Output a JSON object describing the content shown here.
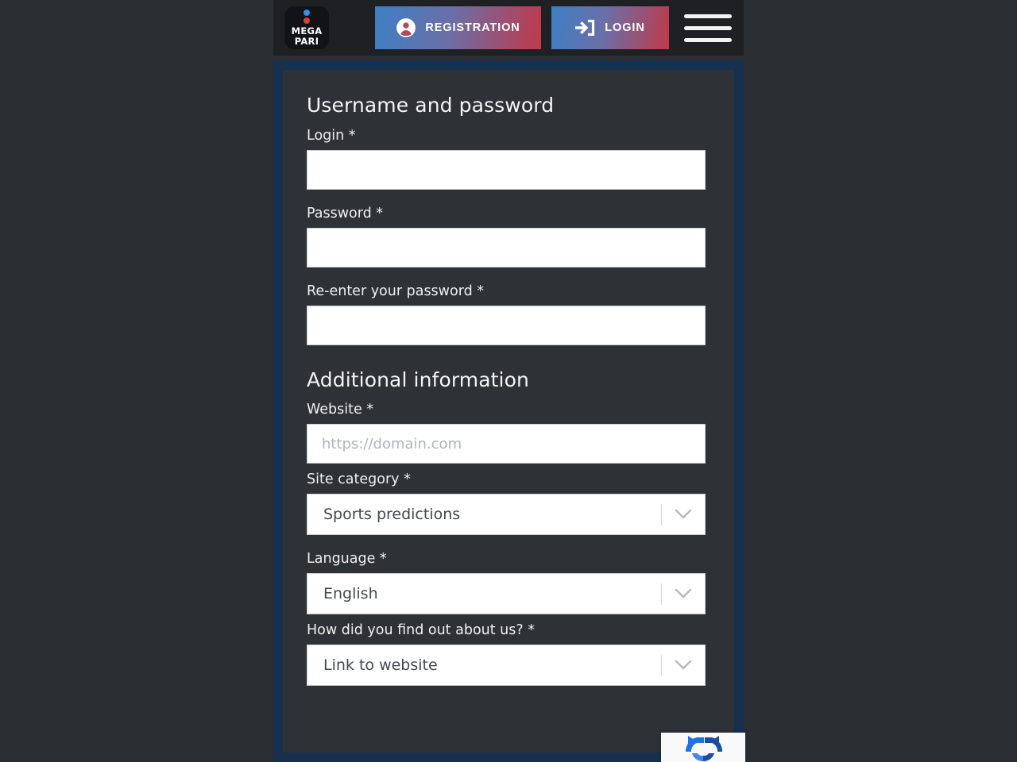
{
  "header": {
    "logo": {
      "line1": "MEGA",
      "line2": "PARI",
      "dot_blue": "#2196f3",
      "dot_red": "#e53935"
    },
    "registration_label": "REGISTRATION",
    "registration_icon": "user-circle-icon",
    "login_label": "LOGIN",
    "login_icon": "login-arrow-icon",
    "menu_icon": "hamburger-menu-icon",
    "gradient_start": "#3d7fc4",
    "gradient_end": "#c0394a"
  },
  "form": {
    "section_credentials": "Username and password",
    "section_additional": "Additional information",
    "fields": {
      "login": {
        "label": "Login *",
        "value": "",
        "placeholder": ""
      },
      "password": {
        "label": "Password *",
        "value": "",
        "placeholder": ""
      },
      "password_repeat": {
        "label": "Re-enter your password *",
        "value": "",
        "placeholder": ""
      },
      "website": {
        "label": "Website *",
        "value": "",
        "placeholder": "https://domain.com"
      },
      "site_category": {
        "label": "Site category *",
        "value": "Sports predictions"
      },
      "language": {
        "label": "Language *",
        "value": "English"
      },
      "referral": {
        "label": "How did you find out about us? *",
        "value": "Link to website"
      }
    }
  },
  "recaptcha": {
    "icon": "recaptcha-logo-icon"
  },
  "colors": {
    "page_background": "#2a2d31",
    "header_background": "#1e2023",
    "frame_border": "#16304f",
    "panel_background": "#2e3136"
  }
}
